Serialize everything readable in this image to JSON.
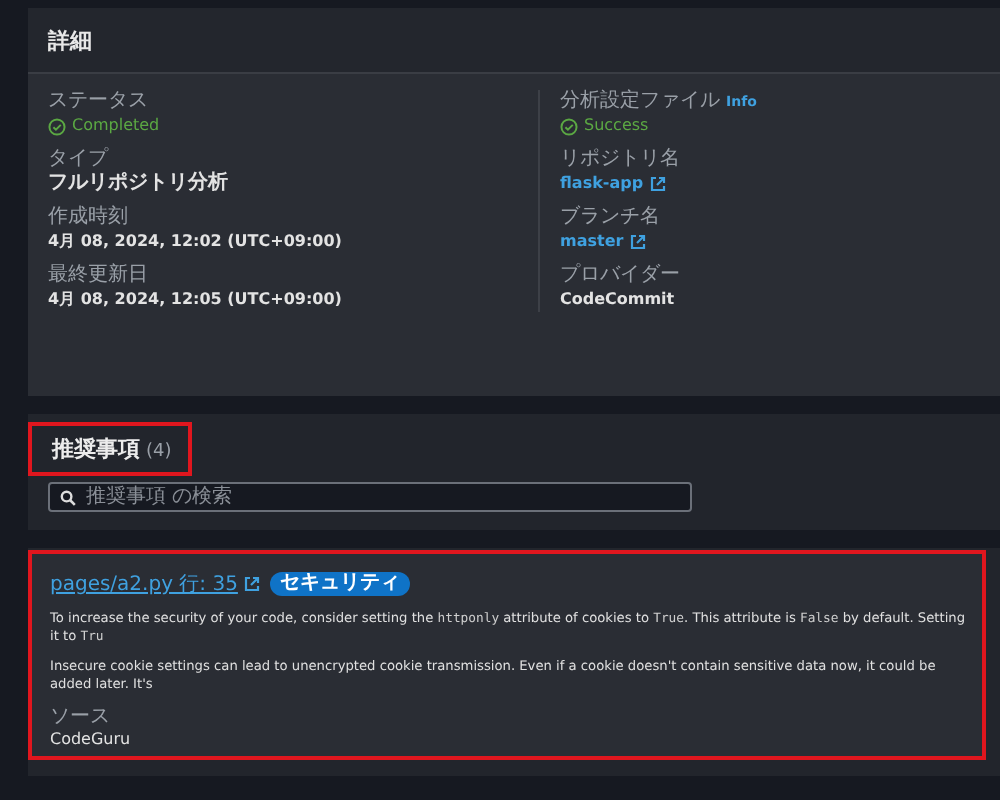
{
  "details": {
    "title": "詳細",
    "columns": [
      [
        {
          "label": "ステータス",
          "kind": "status",
          "value": "Completed"
        },
        {
          "label": "タイプ",
          "kind": "text",
          "value": "フルリポジトリ分析"
        },
        {
          "label": "作成時刻",
          "kind": "text",
          "value": "4月 08, 2024, 12:02 (UTC+09:00)"
        },
        {
          "label": "最終更新日",
          "kind": "text",
          "value": "4月 08, 2024, 12:05 (UTC+09:00)"
        }
      ],
      [
        {
          "label": "分析設定ファイル",
          "info": "Info",
          "kind": "status",
          "value": "Success"
        },
        {
          "label": "リポジトリ名",
          "kind": "link",
          "value": "flask-app"
        },
        {
          "label": "ブランチ名",
          "kind": "link",
          "value": "master"
        },
        {
          "label": "プロバイダー",
          "kind": "text",
          "value": "CodeCommit"
        }
      ]
    ]
  },
  "recommendations": {
    "title": "推奨事項",
    "count": "(4)",
    "highlighted": true,
    "search": {
      "placeholder": "推奨事項 の検索"
    }
  },
  "recommendation": {
    "highlighted": true,
    "file_link": "pages/a2.py 行: 35",
    "tag": "セキュリティ",
    "paragraphs": [
      [
        {
          "kind": "text",
          "text": "To increase the security of your code, consider setting the "
        },
        {
          "kind": "code",
          "text": "httponly"
        },
        {
          "kind": "text",
          "text": " attribute of cookies to "
        },
        {
          "kind": "code",
          "text": "True"
        },
        {
          "kind": "text",
          "text": ". This attribute is "
        },
        {
          "kind": "code",
          "text": "False"
        },
        {
          "kind": "text",
          "text": " by default. Setting it to "
        },
        {
          "kind": "code",
          "text": "Tru"
        }
      ],
      [
        {
          "kind": "text",
          "text": "Insecure cookie settings can lead to unencrypted cookie transmission. Even if a cookie doesn't contain sensitive data now, it could be added later. It's"
        }
      ]
    ],
    "source_label": "ソース",
    "source": "CodeGuru"
  }
}
